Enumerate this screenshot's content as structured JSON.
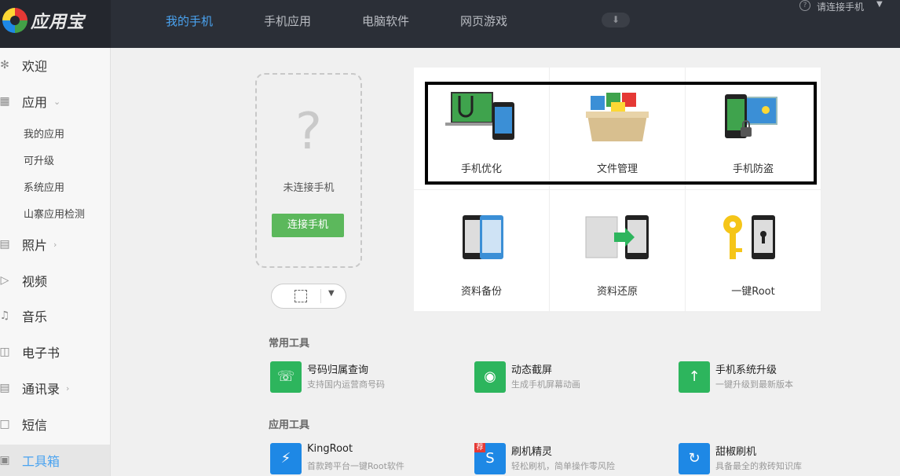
{
  "app": {
    "name": "应用宝"
  },
  "nav": {
    "tabs": [
      {
        "label": "我的手机",
        "active": true
      },
      {
        "label": "手机应用",
        "active": false
      },
      {
        "label": "电脑软件",
        "active": false
      },
      {
        "label": "网页游戏",
        "active": false
      }
    ],
    "download_icon": "download-arrow-icon",
    "help_icon": "question-icon",
    "connect_label": "请连接手机"
  },
  "sidebar": {
    "items": [
      {
        "label": "欢迎",
        "icon": "welcome-icon"
      },
      {
        "label": "应用",
        "icon": "apps-grid-icon",
        "expanded": true
      },
      {
        "label": "照片",
        "icon": "photo-icon"
      },
      {
        "label": "视频",
        "icon": "video-icon"
      },
      {
        "label": "音乐",
        "icon": "music-icon"
      },
      {
        "label": "电子书",
        "icon": "book-icon"
      },
      {
        "label": "通讯录",
        "icon": "contacts-icon"
      },
      {
        "label": "短信",
        "icon": "sms-icon"
      },
      {
        "label": "工具箱",
        "icon": "toolbox-icon",
        "active": true
      }
    ],
    "app_subitems": [
      "我的应用",
      "可升级",
      "系统应用",
      "山寨应用检测"
    ]
  },
  "phone_panel": {
    "status": "未连接手机",
    "connect_button": "连接手机",
    "question_mark": "?"
  },
  "features": [
    {
      "label": "手机优化",
      "icon": "phone-optimize-icon"
    },
    {
      "label": "文件管理",
      "icon": "file-manage-icon"
    },
    {
      "label": "手机防盗",
      "icon": "phone-antitheft-icon"
    },
    {
      "label": "资料备份",
      "icon": "backup-icon"
    },
    {
      "label": "资料还原",
      "icon": "restore-icon"
    },
    {
      "label": "一键Root",
      "icon": "root-key-icon"
    }
  ],
  "common_tools": {
    "title": "常用工具",
    "items": [
      {
        "name": "号码归属查询",
        "desc": "支持国内运营商号码",
        "color": "#2db55d"
      },
      {
        "name": "动态截屏",
        "desc": "生成手机屏幕动画",
        "color": "#2db55d"
      },
      {
        "name": "手机系统升级",
        "desc": "一键升级到最新版本",
        "color": "#2db55d"
      }
    ]
  },
  "app_tools": {
    "title": "应用工具",
    "items": [
      {
        "name": "KingRoot",
        "desc": "首款跨平台一键Root软件",
        "color": "#1e88e5"
      },
      {
        "name": "刷机精灵",
        "desc": "轻松刷机，简单操作零风险",
        "color": "#1e88e5",
        "badge": "荐"
      },
      {
        "name": "甜椒刷机",
        "desc": "具备最全的救砖知识库",
        "color": "#1e88e5"
      }
    ]
  }
}
